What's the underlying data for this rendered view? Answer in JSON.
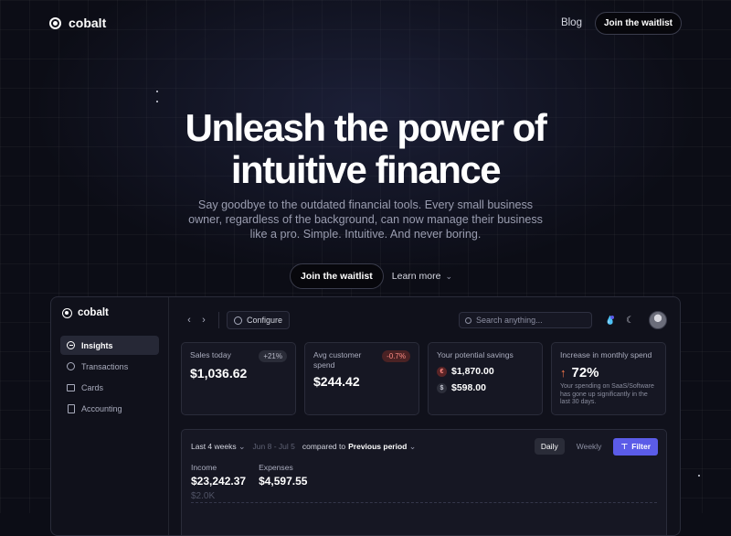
{
  "nav": {
    "brand": "cobalt",
    "blog": "Blog",
    "waitlist": "Join the waitlist"
  },
  "hero": {
    "title_line1": "Unleash the power of",
    "title_line2": "intuitive finance",
    "subtitle": "Say goodbye to the outdated financial tools. Every small business owner, regardless of the background, can now manage their business like a pro. Simple. Intuitive. And never boring.",
    "cta_primary": "Join the waitlist",
    "cta_secondary": "Learn more"
  },
  "app": {
    "brand": "cobalt",
    "sidebar": [
      {
        "label": "Insights"
      },
      {
        "label": "Transactions"
      },
      {
        "label": "Cards"
      },
      {
        "label": "Accounting"
      }
    ],
    "toolbar": {
      "back": "‹",
      "forward": "›",
      "configure": "Configure",
      "search_placeholder": "Search anything..."
    },
    "cards": {
      "sales": {
        "label": "Sales today",
        "value": "$1,036.62",
        "badge": "+21%"
      },
      "avg": {
        "label": "Avg customer spend",
        "value": "$244.42",
        "badge": "-0.7%"
      },
      "savings": {
        "label": "Your potential savings",
        "eur_symbol": "€",
        "eur": "$1,870.00",
        "usd_symbol": "$",
        "usd": "$598.00"
      },
      "increase": {
        "label": "Increase in monthly spend",
        "value": "72%",
        "note": "Your spending on SaaS/Software has gone up significantly in the last 30 days."
      }
    },
    "panel": {
      "range": "Last 4 weeks",
      "dates": "Jun 8 - Jul 5",
      "compared_to": "compared to",
      "period": "Previous period",
      "daily": "Daily",
      "weekly": "Weekly",
      "filter": "Filter",
      "income_label": "Income",
      "income_value": "$23,242.37",
      "expenses_label": "Expenses",
      "expenses_value": "$4,597.55",
      "y_tick": "$2.0K"
    }
  },
  "colors": {
    "accent": "#5b5ce8",
    "background": "#0c0d16",
    "negative": "#ff8b84"
  }
}
